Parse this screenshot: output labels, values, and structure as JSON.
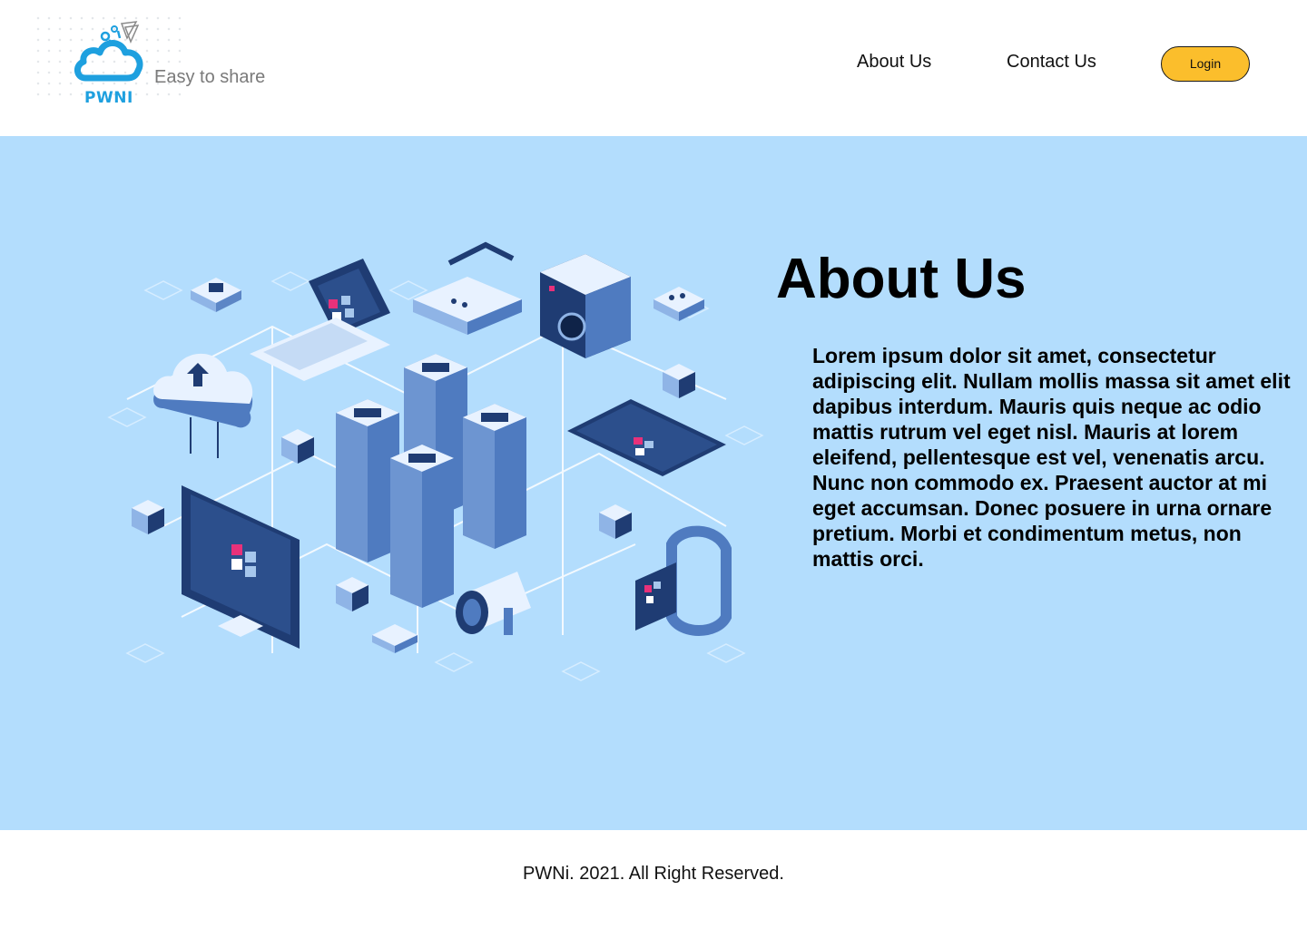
{
  "header": {
    "logo_text": "PWNI",
    "tagline": "Easy to share",
    "nav": {
      "about_label": "About Us",
      "contact_label": "Contact Us",
      "login_label": "Login"
    }
  },
  "hero": {
    "title": "About Us",
    "body": "Lorem ipsum dolor sit amet, consectetur adipiscing elit. Nullam mollis massa sit amet elit dapibus interdum. Mauris quis neque ac odio mattis rutrum vel eget nisl. Mauris at lorem eleifend, pellentesque est vel, venenatis arcu. Nunc non commodo ex. Praesent auctor at mi eget accumsan. Donec posuere in urna ornare pretium. Morbi et condimentum metus, non mattis orci.",
    "illustration": "isometric-cloud-network-illustration"
  },
  "footer": {
    "copyright": "PWNi. 2021. All Right Reserved."
  },
  "colors": {
    "brand_blue": "#1ea0df",
    "hero_bg": "#b3ddfd",
    "login_bg": "#fbbe2c",
    "navy": "#1f3c73"
  }
}
